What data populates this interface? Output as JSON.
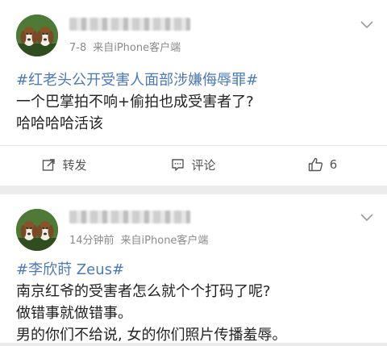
{
  "posts": [
    {
      "meta": {
        "time": "7-8",
        "source": "来自iPhone客户端"
      },
      "topic": "#红老头公开受害人面部涉嫌侮辱罪#",
      "lines": [
        "一个巴掌拍不响+偷拍也成受害者了?",
        "哈哈哈哈活该"
      ],
      "actions": {
        "repost": "转发",
        "comment": "评论",
        "like_count": "6"
      }
    },
    {
      "meta": {
        "time": "14分钟前",
        "source": "来自iPhone客户端"
      },
      "topic": "#李欣莳 Zeus#",
      "lines": [
        "南京红爷的受害者怎么就个个打码了呢?",
        "做错事就做错事。",
        "男的你们不给说, 女的你们照片传播羞辱。"
      ]
    }
  ],
  "icons": [
    "avatar-beagle-dogs",
    "chevron-down-icon",
    "repost-icon",
    "comment-icon",
    "like-icon"
  ]
}
